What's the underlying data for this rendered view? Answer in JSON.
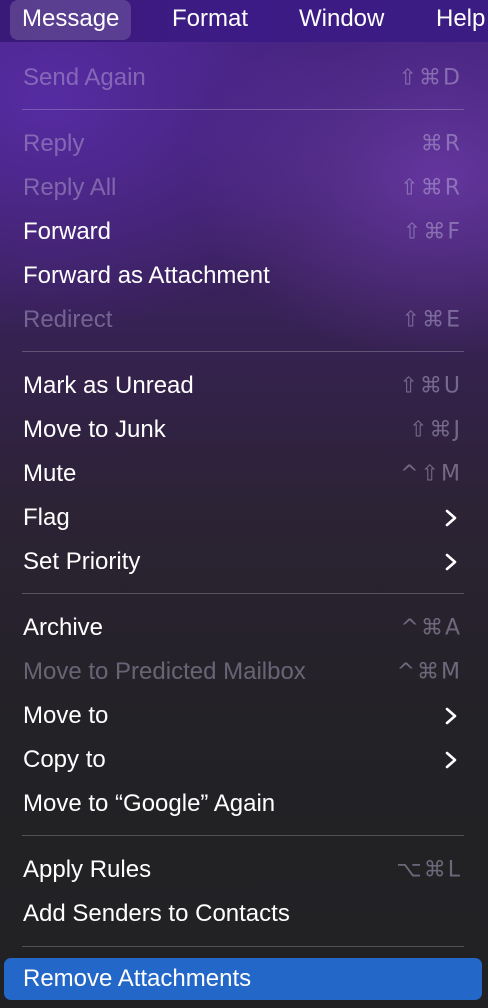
{
  "menubar": {
    "items": [
      {
        "label": "Message"
      },
      {
        "label": "Format"
      },
      {
        "label": "Window"
      },
      {
        "label": "Help"
      }
    ]
  },
  "menu": {
    "items": [
      {
        "label": "Send Again",
        "shortcut": "⇧⌘D",
        "enabled": false
      },
      {
        "label": "Reply",
        "shortcut": "⌘R",
        "enabled": false
      },
      {
        "label": "Reply All",
        "shortcut": "⇧⌘R",
        "enabled": false
      },
      {
        "label": "Forward",
        "shortcut": "⇧⌘F",
        "enabled": true
      },
      {
        "label": "Forward as Attachment",
        "shortcut": "",
        "enabled": true
      },
      {
        "label": "Redirect",
        "shortcut": "⇧⌘E",
        "enabled": false
      },
      {
        "label": "Mark as Unread",
        "shortcut": "⇧⌘U",
        "enabled": true
      },
      {
        "label": "Move to Junk",
        "shortcut": "⇧⌘J",
        "enabled": true
      },
      {
        "label": "Mute",
        "shortcut": "^⇧M",
        "enabled": true
      },
      {
        "label": "Flag",
        "submenu": true,
        "enabled": true
      },
      {
        "label": "Set Priority",
        "submenu": true,
        "enabled": true
      },
      {
        "label": "Archive",
        "shortcut": "^⌘A",
        "enabled": true
      },
      {
        "label": "Move to Predicted Mailbox",
        "shortcut": "^⌘M",
        "enabled": false
      },
      {
        "label": "Move to",
        "submenu": true,
        "enabled": true
      },
      {
        "label": "Copy to",
        "submenu": true,
        "enabled": true
      },
      {
        "label": "Move to “Google” Again",
        "shortcut": "",
        "enabled": true
      },
      {
        "label": "Apply Rules",
        "shortcut": "⌥⌘L",
        "enabled": true
      },
      {
        "label": "Add Senders to Contacts",
        "shortcut": "",
        "enabled": true
      },
      {
        "label": "Remove Attachments",
        "shortcut": "",
        "enabled": true,
        "highlighted": true
      }
    ],
    "chevron_icon": "chevron-right-icon",
    "highlight_color": "#2367c9"
  }
}
